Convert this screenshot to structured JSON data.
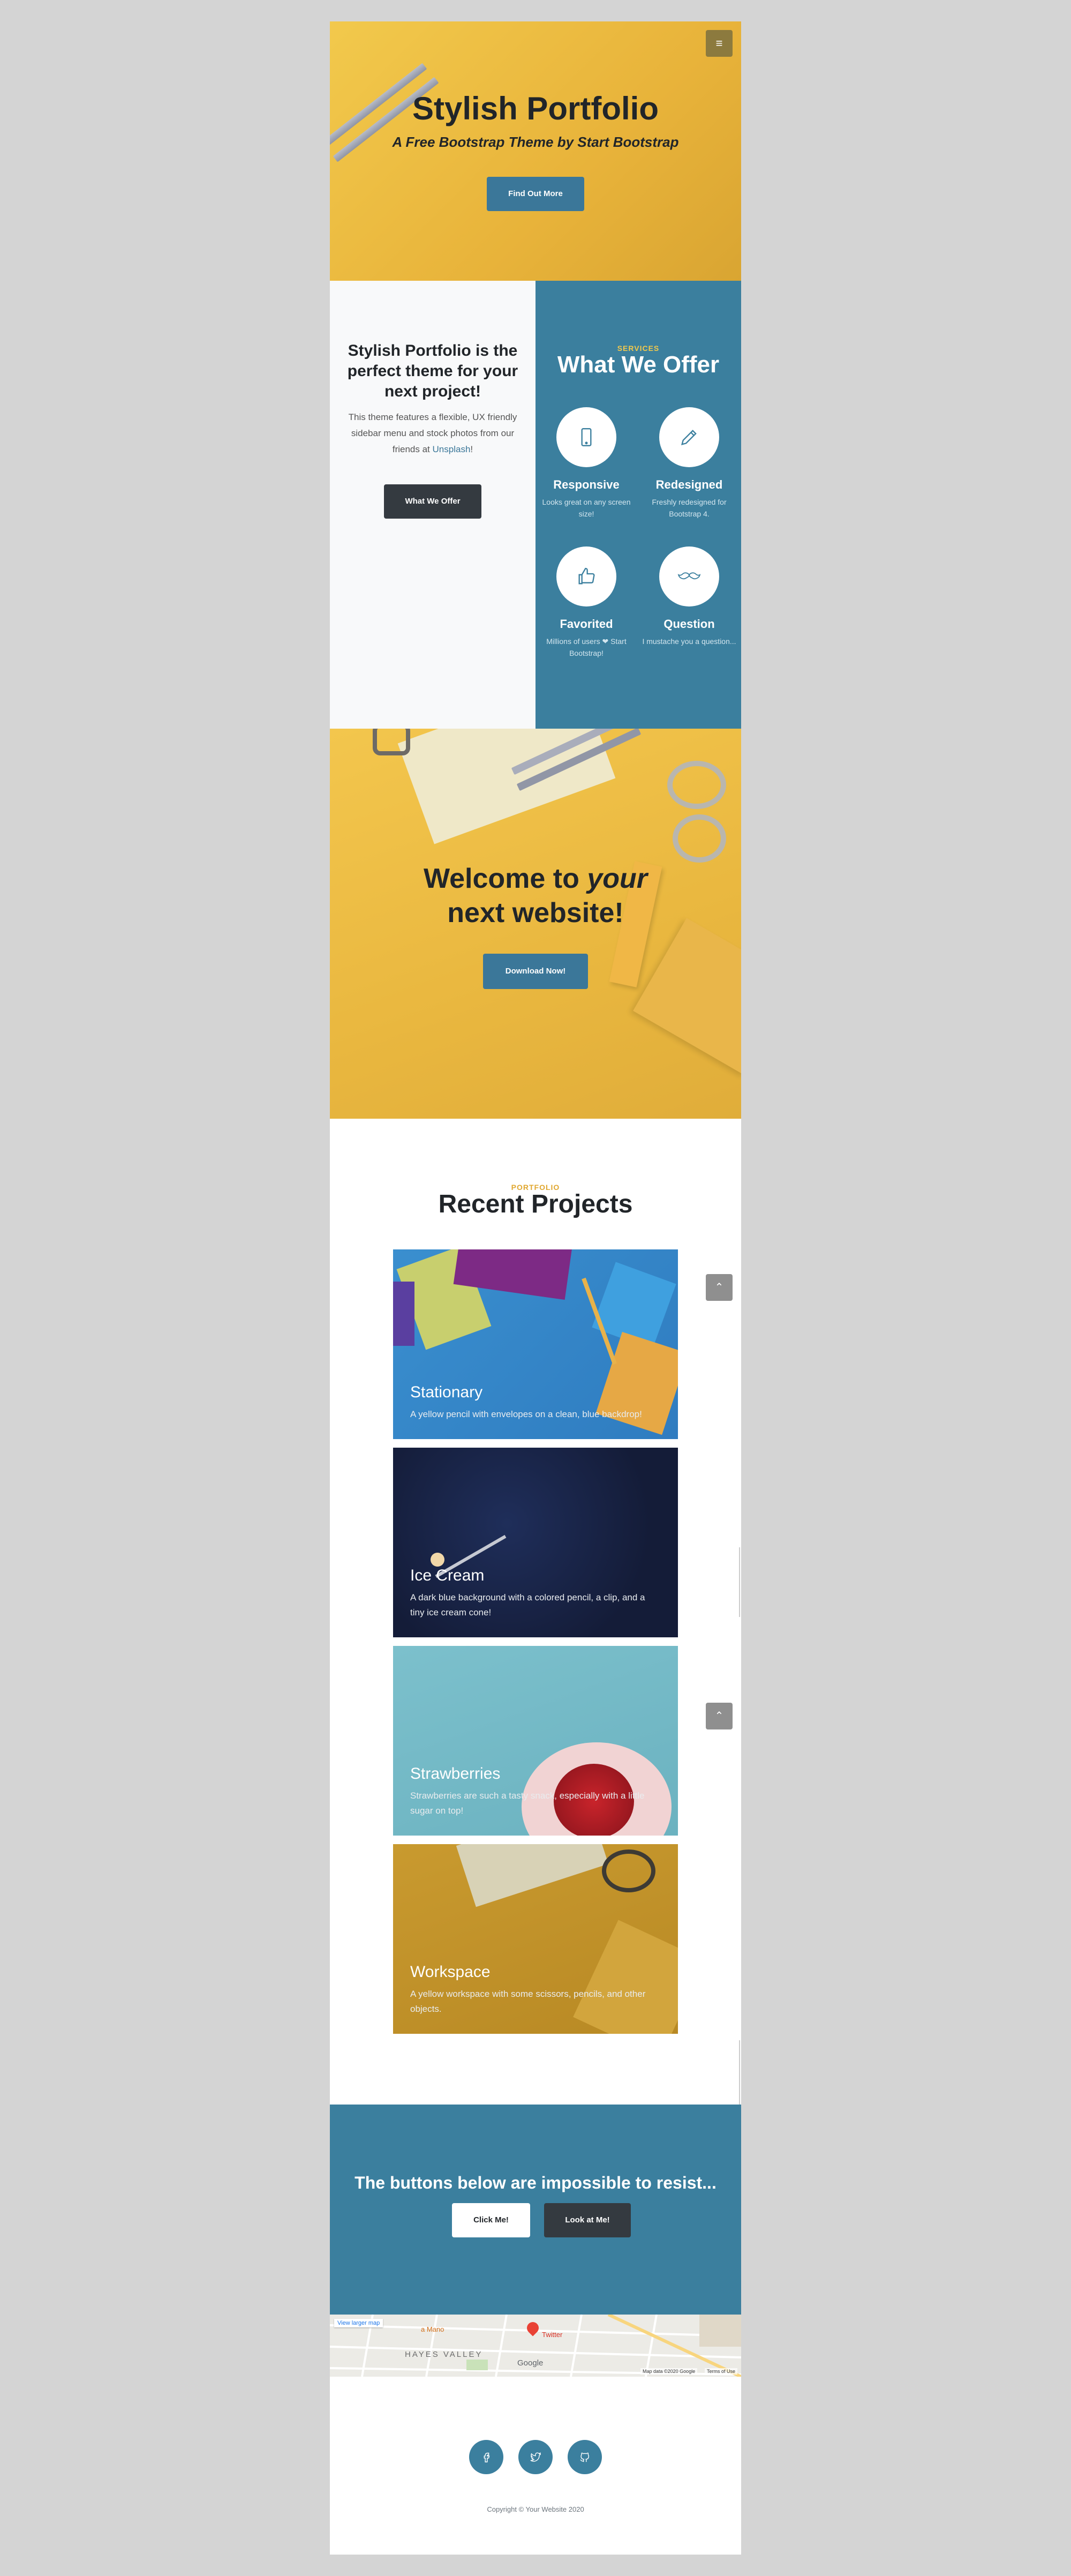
{
  "colors": {
    "accent": "#3b7f9e",
    "yellow": "#f2c94c",
    "dark": "#343a40"
  },
  "nav": {
    "menu_icon": "hamburger-icon",
    "menu_glyph": "≡"
  },
  "hero": {
    "title": "Stylish Portfolio",
    "subtitle": "A Free Bootstrap Theme by Start Bootstrap",
    "button": "Find Out More"
  },
  "about": {
    "heading": "Stylish Portfolio is the perfect theme for your next project!",
    "text": "This theme features a flexible, UX friendly sidebar menu and stock photos from our friends at",
    "link": "Unsplash",
    "text_end": "!",
    "button": "What We Offer"
  },
  "services": {
    "kicker": "SERVICES",
    "heading": "What We Offer",
    "items": [
      {
        "icon": "phone-icon",
        "title": "Responsive",
        "text": "Looks great on any screen size!"
      },
      {
        "icon": "pencil-icon",
        "title": "Redesigned",
        "text": "Freshly redesigned for Bootstrap 4."
      },
      {
        "icon": "thumbs-up-icon",
        "title": "Favorited",
        "text": "Millions of users ❤ Start Bootstrap!"
      },
      {
        "icon": "mustache-icon",
        "title": "Question",
        "text": "I mustache you a question..."
      }
    ]
  },
  "callout": {
    "line1_a": "Welcome to ",
    "line1_b": "your",
    "line2": "next website!",
    "button": "Download Now!"
  },
  "portfolio": {
    "kicker": "PORTFOLIO",
    "heading": "Recent Projects",
    "items": [
      {
        "title": "Stationary",
        "text": "A yellow pencil with envelopes on a clean, blue backdrop!"
      },
      {
        "title": "Ice Cream",
        "text": "A dark blue background with a colored pencil, a clip, and a tiny ice cream cone!"
      },
      {
        "title": "Strawberries",
        "text": "Strawberries are such a tasty snack, especially with a little sugar on top!"
      },
      {
        "title": "Workspace",
        "text": "A yellow workspace with some scissors, pencils, and other objects."
      }
    ],
    "scroll_glyph": "⌃"
  },
  "cta": {
    "heading": "The buttons below are impossible to resist...",
    "button1": "Click Me!",
    "button2": "Look at Me!"
  },
  "map": {
    "view_larger": "View larger map",
    "place1": "a Mano",
    "place2": "Twitter",
    "district": "HAYES VALLEY",
    "google": "Google",
    "map_data": "Map data ©2020 Google",
    "terms": "Terms of Use"
  },
  "footer": {
    "social": [
      "facebook-icon",
      "twitter-icon",
      "github-icon"
    ],
    "copyright": "Copyright © Your Website 2020"
  }
}
